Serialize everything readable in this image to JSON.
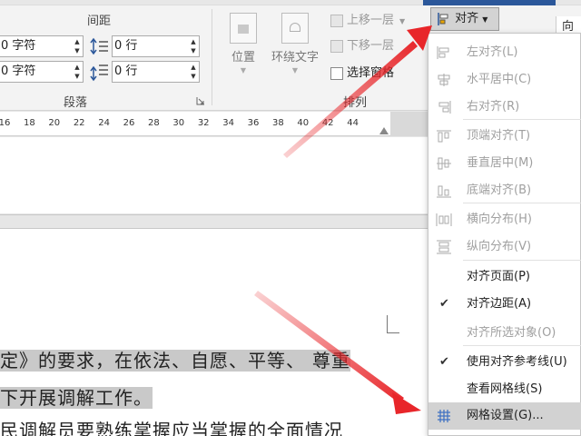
{
  "ribbon": {
    "groups": {
      "spacing_title": "间距",
      "paragraph_title": "段落",
      "arrange_title": "排列"
    },
    "indent": {
      "left_value": "0 字符",
      "right_value": "0 字符"
    },
    "spacing": {
      "before_value": "0 行",
      "after_value": "0 行"
    },
    "position_label": "位置",
    "wrap_text_label": "环绕文字",
    "bring_forward_label": "上移一层",
    "send_backward_label": "下移一层",
    "selection_pane_label": "选择窗格",
    "align_label": "对齐",
    "right_partial_label": "向"
  },
  "ruler": {
    "ticks": [
      "16",
      "18",
      "20",
      "22",
      "24",
      "26",
      "28",
      "30",
      "32",
      "34",
      "36",
      "38",
      "40",
      "42",
      "44"
    ]
  },
  "document": {
    "line1_a": "定》的要求，在依法、自愿、平等、",
    "line1_b": "尊重",
    "line2": "下开展调解工作。",
    "line3": "民调解员要熟练掌握应当掌握的全面情况"
  },
  "align_menu": {
    "items": [
      {
        "label": "左对齐(L)",
        "enabled": false,
        "checked": false,
        "icon": "align-left-icon"
      },
      {
        "label": "水平居中(C)",
        "enabled": false,
        "checked": false,
        "icon": "align-center-icon"
      },
      {
        "label": "右对齐(R)",
        "enabled": false,
        "checked": false,
        "icon": "align-right-icon"
      },
      {
        "label": "顶端对齐(T)",
        "enabled": false,
        "checked": false,
        "icon": "align-top-icon"
      },
      {
        "label": "垂直居中(M)",
        "enabled": false,
        "checked": false,
        "icon": "align-middle-icon"
      },
      {
        "label": "底端对齐(B)",
        "enabled": false,
        "checked": false,
        "icon": "align-bottom-icon"
      },
      {
        "label": "横向分布(H)",
        "enabled": false,
        "checked": false,
        "icon": "distribute-horizontal-icon"
      },
      {
        "label": "纵向分布(V)",
        "enabled": false,
        "checked": false,
        "icon": "distribute-vertical-icon"
      },
      {
        "label": "对齐页面(P)",
        "enabled": true,
        "checked": false,
        "icon": ""
      },
      {
        "label": "对齐边距(A)",
        "enabled": true,
        "checked": true,
        "icon": ""
      },
      {
        "label": "对齐所选对象(O)",
        "enabled": false,
        "checked": false,
        "icon": ""
      },
      {
        "label": "使用对齐参考线(U)",
        "enabled": true,
        "checked": true,
        "icon": ""
      },
      {
        "label": "查看网格线(S)",
        "enabled": true,
        "checked": false,
        "icon": ""
      },
      {
        "label": "网格设置(G)...",
        "enabled": true,
        "checked": false,
        "icon": "grid-icon",
        "highlighted": true
      }
    ]
  },
  "colors": {
    "arrow": "#e8262a",
    "accent": "#2b579a",
    "highlight": "#c9c9c9"
  }
}
